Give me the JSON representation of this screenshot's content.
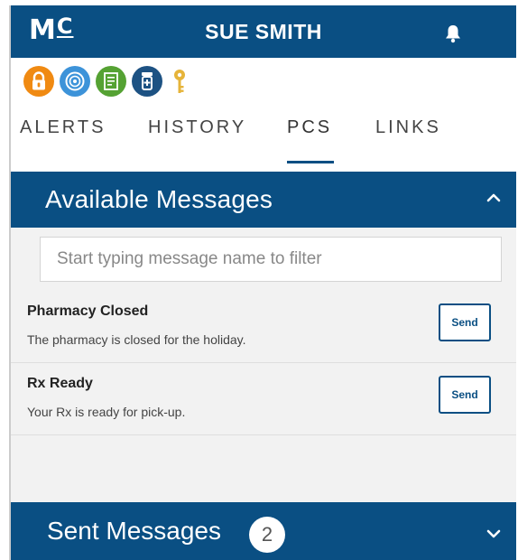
{
  "header": {
    "logo": {
      "main": "M",
      "sub": "C"
    },
    "user_name": "SUE SMITH"
  },
  "status_icons": [
    {
      "name": "lock-icon",
      "color": "#f08a12"
    },
    {
      "name": "target-icon",
      "color": "#3d93d9"
    },
    {
      "name": "document-icon",
      "color": "#55a233"
    },
    {
      "name": "pill-bottle-icon",
      "color": "#1d5283"
    },
    {
      "name": "key-icon",
      "color": "#e6b43a"
    }
  ],
  "tabs": [
    {
      "label": "ALERTS",
      "active": false
    },
    {
      "label": "HISTORY",
      "active": false
    },
    {
      "label": "PCS",
      "active": true
    },
    {
      "label": "LINKS",
      "active": false
    }
  ],
  "available": {
    "title": "Available Messages",
    "filter_placeholder": "Start typing message name to filter",
    "filter_value": "",
    "messages": [
      {
        "name": "Pharmacy Closed",
        "description": "The pharmacy is closed for the holiday.",
        "button": "Send"
      },
      {
        "name": "Rx Ready",
        "description": "Your Rx is ready for pick-up.",
        "button": "Send"
      }
    ]
  },
  "sent": {
    "title": "Sent Messages",
    "count": "2"
  },
  "colors": {
    "brand": "#0a4f83",
    "panel_bg": "#f2f2f2"
  }
}
